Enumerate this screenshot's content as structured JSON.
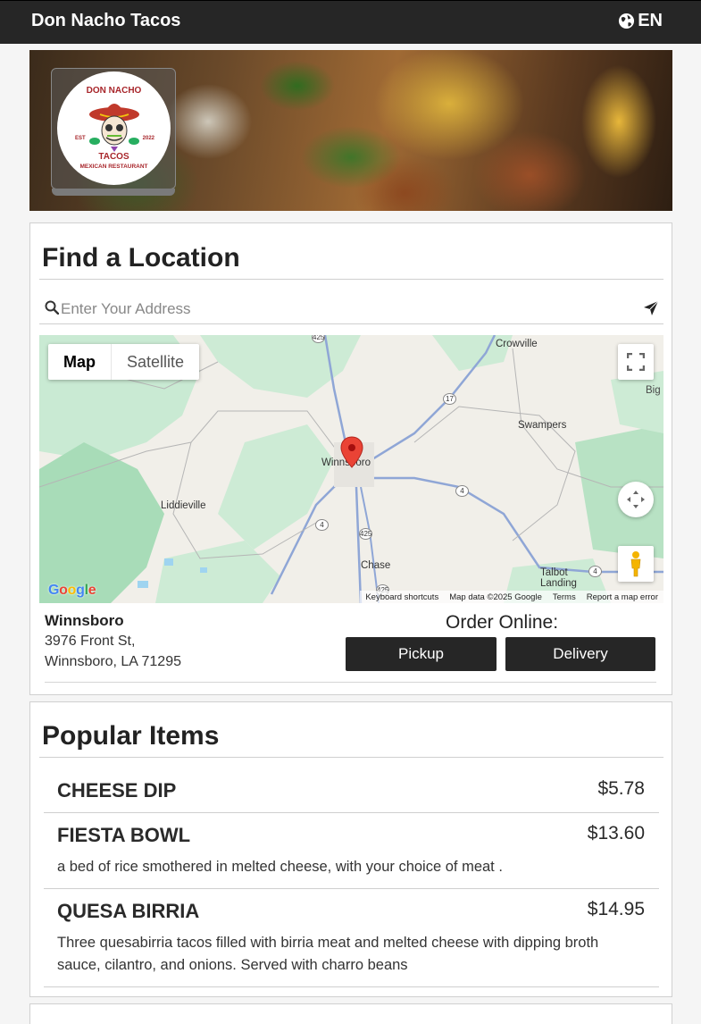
{
  "header": {
    "brand": "Don Nacho Tacos",
    "language": "EN",
    "language_icon": "globe-icon"
  },
  "hero": {
    "logo": {
      "line1": "DON NACHO",
      "line2": "TACOS",
      "line3": "MEXICAN RESTAURANT",
      "est": "EST",
      "year": "2022"
    }
  },
  "find_location": {
    "title": "Find a Location",
    "search_placeholder": "Enter Your Address",
    "map": {
      "type_options": [
        "Map",
        "Satellite"
      ],
      "selected_type": "Map",
      "places": [
        "Crowville",
        "Big State Mana",
        "Swampers",
        "Winnsboro",
        "Liddieville",
        "Chase",
        "Talbot Landing"
      ],
      "routes": [
        "425",
        "17",
        "4",
        "4",
        "425",
        "4",
        "425"
      ],
      "attribution": [
        "Keyboard shortcuts",
        "Map data ©2025 Google",
        "Terms",
        "Report a map error"
      ],
      "google_logo": "Google"
    },
    "location": {
      "name": "Winnsboro",
      "address_line1": "3976 Front St,",
      "address_line2": "Winnsboro, LA 71295"
    },
    "order": {
      "label": "Order Online:",
      "pickup": "Pickup",
      "delivery": "Delivery"
    }
  },
  "popular": {
    "title": "Popular Items",
    "items": [
      {
        "name": "CHEESE DIP",
        "price": "$5.78",
        "description": ""
      },
      {
        "name": "FIESTA BOWL",
        "price": "$13.60",
        "description": "a bed of rice smothered in melted cheese, with your choice of meat ."
      },
      {
        "name": "QUESA BIRRIA",
        "price": "$14.95",
        "description": "Three quesabirria tacos filled with birria meat and melted cheese with dipping broth sauce, cilantro, and onions. Served with charro beans"
      }
    ]
  }
}
